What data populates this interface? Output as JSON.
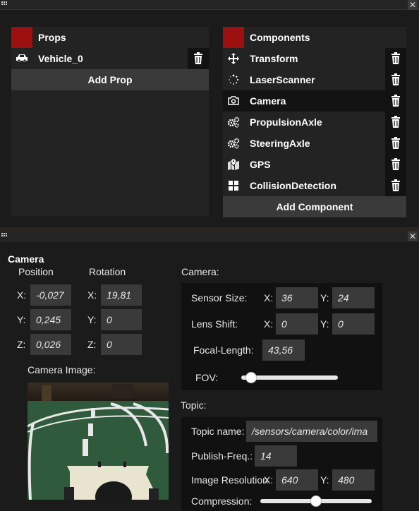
{
  "props_panel": {
    "title": "Props",
    "items": [
      {
        "label": "Vehicle_0",
        "icon": "car-icon"
      }
    ],
    "add_label": "Add Prop"
  },
  "components_panel": {
    "title": "Components",
    "items": [
      {
        "label": "Transform",
        "icon": "move-arrows-icon"
      },
      {
        "label": "LaserScanner",
        "icon": "dotted-circle-icon"
      },
      {
        "label": "Camera",
        "icon": "camera-icon",
        "selected": true
      },
      {
        "label": "PropulsionAxle",
        "icon": "gears-icon"
      },
      {
        "label": "SteeringAxle",
        "icon": "gears-icon"
      },
      {
        "label": "GPS",
        "icon": "map-marker-icon"
      },
      {
        "label": "CollisionDetection",
        "icon": "window-grid-icon"
      }
    ],
    "add_label": "Add Component"
  },
  "inspector": {
    "title": "Camera",
    "position_label": "Position",
    "rotation_label": "Rotation",
    "axis_x": "X:",
    "axis_y": "Y:",
    "axis_z": "Z:",
    "position": {
      "x": "-0,027",
      "y": "0,245",
      "z": "0,026"
    },
    "rotation": {
      "x": "19,81",
      "y": "0",
      "z": "0"
    },
    "camera_image_label": "Camera Image:",
    "camera_section": "Camera:",
    "sensor_size_label": "Sensor Size:",
    "sensor_size": {
      "x": "36",
      "y": "24"
    },
    "lens_shift_label": "Lens Shift:",
    "lens_shift": {
      "x": "0",
      "y": "0"
    },
    "focal_length_label": "Focal-Length:",
    "focal_length": "43,56",
    "fov_label": "FOV:",
    "fov_level": 0.1,
    "topic_section": "Topic:",
    "topic_name_label": "Topic name:",
    "topic_name": "/sensors/camera/color/ima",
    "publish_freq_label": "Publish-Freq.:",
    "publish_freq": "14",
    "image_resolution_label": "Image Resolution",
    "image_resolution": {
      "x": "640",
      "y": "480"
    },
    "compression_label": "Compression:",
    "compression_level": 0.5
  },
  "colors": {
    "accent_swatch": "#9e1010",
    "track_green": "#2f5a3c"
  }
}
